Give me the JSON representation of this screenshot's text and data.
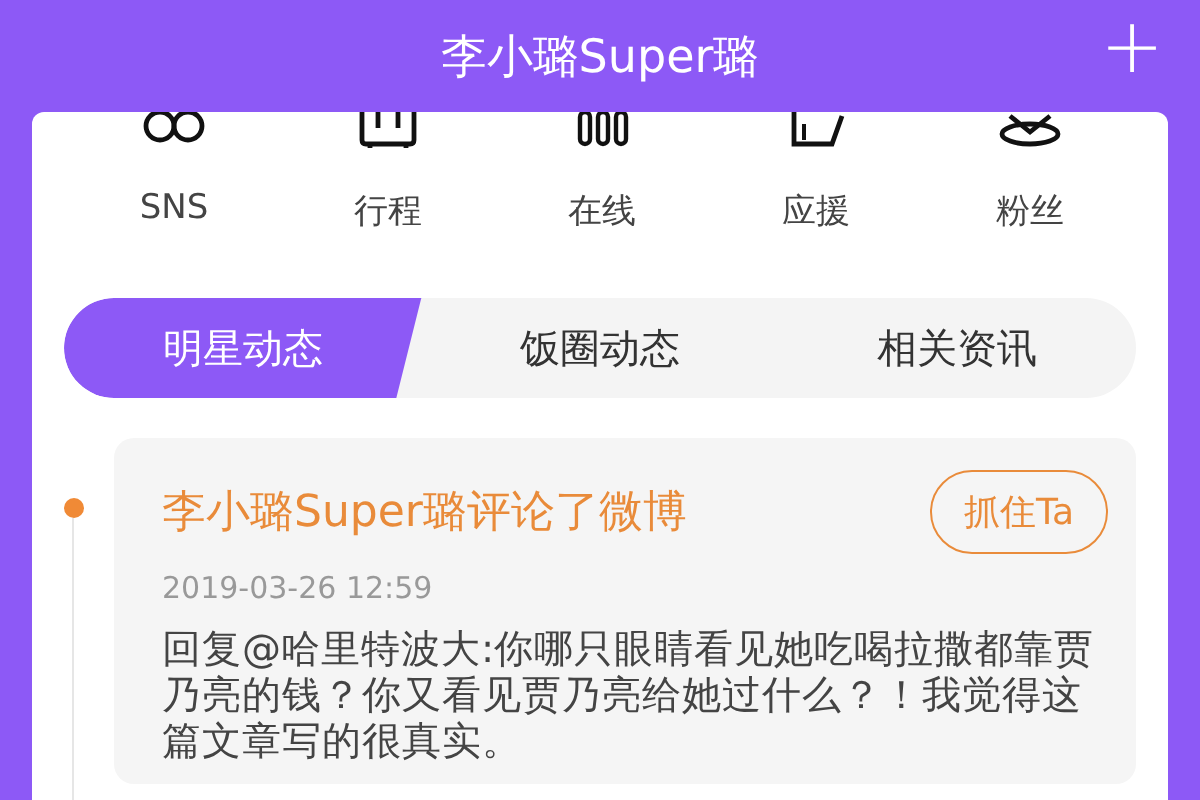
{
  "header": {
    "title": "李小璐Super璐",
    "action": "+"
  },
  "shortcuts": [
    {
      "label": "SNS",
      "kind": "rings"
    },
    {
      "label": "行程",
      "kind": "suitcase"
    },
    {
      "label": "在线",
      "kind": "bars"
    },
    {
      "label": "应援",
      "kind": "bag"
    },
    {
      "label": "粉丝",
      "kind": "pin"
    }
  ],
  "tabs": [
    {
      "label": "明星动态",
      "selected": true
    },
    {
      "label": "饭圈动态",
      "selected": false
    },
    {
      "label": "相关资讯",
      "selected": false
    }
  ],
  "posts": [
    {
      "title": "李小璐Super璐评论了微博",
      "button": "抓住Ta",
      "time": "2019-03-26 12:59",
      "body": "回复@哈里特波大:你哪只眼睛看见她吃喝拉撒都靠贾乃亮的钱？你又看见贾乃亮给她过什么？！我觉得这篇文章写的很真实。"
    }
  ]
}
